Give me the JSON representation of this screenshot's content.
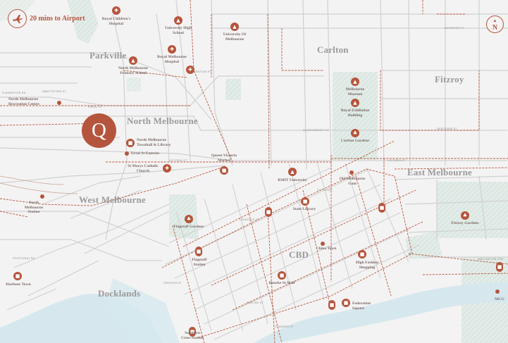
{
  "badge": {
    "airport": "20 mins to Airport",
    "north": "N"
  },
  "marker": {
    "letter": "Q"
  },
  "colors": {
    "accent": "#b5553d",
    "road": "#cfcfcf",
    "park": "#d9e6df",
    "water": "#cfe4ea",
    "background": "#f4f3f3"
  },
  "suburbs": {
    "parkville": "Parkville",
    "carlton": "Carlton",
    "fitzroy": "Fitzroy",
    "north_melbourne": "North Melbourne",
    "west_melbourne": "West Melbourne",
    "east_melbourne": "East Melbourne",
    "cbd": "CBD",
    "docklands": "Docklands"
  },
  "pois": {
    "royal_childrens": "Royal Children's Hospital",
    "university_high": "University High School",
    "university_melbourne": "University Of Melbourne",
    "royal_melbourne_hospital": "Royal Melbourne Hospital",
    "north_melbourne_primary": "North Melbourne Primary School",
    "north_melbourne_recreation": "North Melbourne Recreation Centre",
    "melbourne_museum": "Melbourne Museum",
    "royal_exhibition": "Royal Exhibition Building",
    "carlton_gardens": "Carlton Gardens",
    "north_melbourne_library": "North Melbourne Townhall & Library",
    "errol_st": "Errol St Eateries",
    "st_marys": "St Marys Catholic Church",
    "queen_victoria": "Queen Victoria Market",
    "rmit": "RMIT University",
    "old_gaol": "Old Melbourne Gaol",
    "north_melbourne_station": "North Melbourne Station",
    "state_library": "State Library",
    "flagstaff_gardens": "Flagstaff Gardens",
    "fitzroy_gardens": "Fitzroy Gardens",
    "china_town": "China Town",
    "flagstaff_station": "Flagstaff Station",
    "high_fashion": "High Fashion Shopping",
    "harbour_town": "Harbour Town",
    "bourke_st_mall": "Bourke St Mall",
    "federation_square": "Federation Square",
    "mcg": "MCG",
    "southern_cross": "Southern Cross Station"
  },
  "streets": {
    "flemington": "FLEMINGTON RD",
    "grattan": "GRATTAN ST",
    "queensberry": "QUEENSBERRY ST",
    "victoria": "VICTORIA ST",
    "dudley": "DUDLEY ST",
    "lonsdale": "LONSDALE ST",
    "collins": "COLLINS ST",
    "flinders": "FLINDERS ST",
    "spencer": "SPENCER ST",
    "elizabeth": "ELIZABETH ST",
    "swanston": "SWANSTON ST",
    "russell": "RUSSELL ST",
    "exhibition": "EXHIBITION ST",
    "lygon": "LYGON ST",
    "nicholson": "NICHOLSON ST",
    "brunswick": "BRUNSWICK ST",
    "smith": "SMITH ST",
    "gertrude": "GERTRUDE ST",
    "johnston": "JOHNSTON ST",
    "wellington": "WELLINGTON PDE",
    "harbour_esp": "HARBOUR ESP",
    "footscray": "FOOTSCRAY RD",
    "errol": "ERROL ST",
    "abbotsford": "ABBOTSFORD ST",
    "city_loop": "CITY LOOP"
  }
}
